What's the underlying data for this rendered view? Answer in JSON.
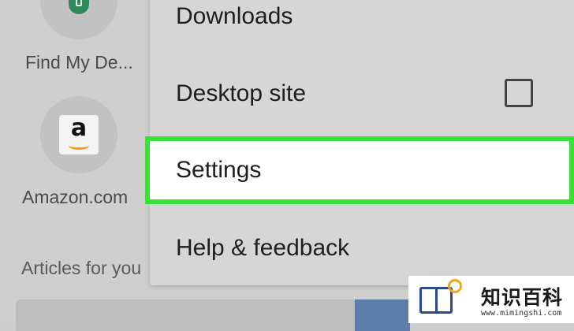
{
  "shortcuts": [
    {
      "label": "Find My De...",
      "icon": "find-my-device-icon",
      "color": "#2e8b57"
    },
    {
      "label": "Amazon.com",
      "icon": "amazon-icon",
      "logo_letter": "a",
      "color": "#ff9900"
    }
  ],
  "articles_heading": "Articles for you",
  "menu": {
    "downloads_label": "Downloads",
    "desktop_site_label": "Desktop site",
    "desktop_site_checked": false,
    "settings_label": "Settings",
    "help_label": "Help & feedback",
    "highlight_color": "#38e038"
  },
  "watermark": {
    "title": "知识百科",
    "url": "www.mimingshi.com"
  }
}
